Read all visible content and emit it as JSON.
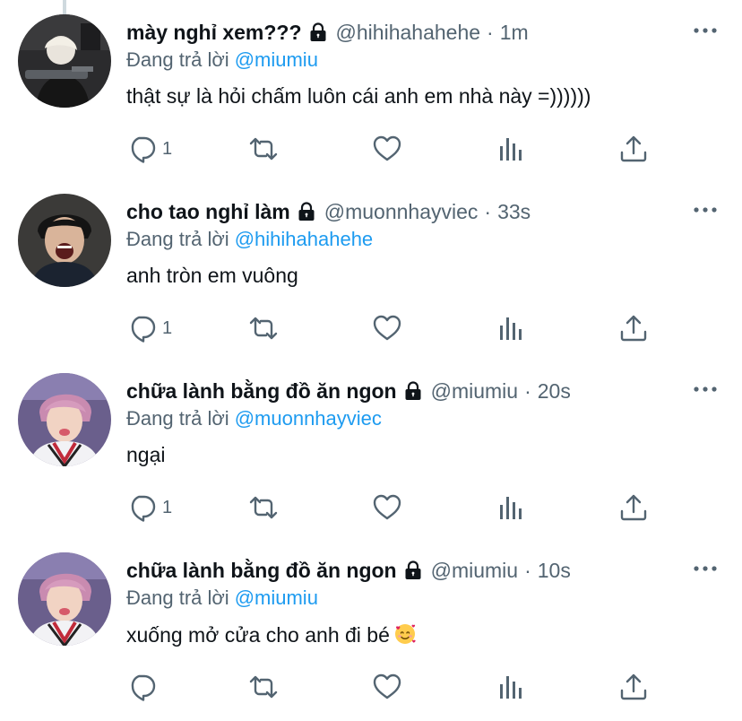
{
  "colors": {
    "text": "#0f1419",
    "secondary": "#536471",
    "link": "#1d9bf0",
    "thread_line": "#cfd9de"
  },
  "icons": {
    "lock": "lock-icon",
    "more": "more-dots-icon",
    "reply": "reply-bubble-icon",
    "retweet": "retweet-icon",
    "like": "heart-icon",
    "stats": "analytics-bars-icon",
    "share": "share-upload-icon",
    "emoji": "smiling-face-with-hearts-emoji"
  },
  "tweets": [
    {
      "name": "mày nghỉ xem???",
      "handle": "@hihihahahehe",
      "time": "1m",
      "reply_prefix": "Đang trả lời",
      "reply_to": "@miumiu",
      "text": "thật sự là hỏi chấm luôn cái anh em nhà này =))))))",
      "reply_count": "1"
    },
    {
      "name": "cho tao nghỉ làm",
      "handle": "@muonnhayviec",
      "time": "33s",
      "reply_prefix": "Đang trả lời",
      "reply_to": "@hihihahahehe",
      "text": "anh tròn em vuông",
      "reply_count": "1"
    },
    {
      "name": "chữa lành bằng đồ ăn ngon",
      "handle": "@miumiu",
      "time": "20s",
      "reply_prefix": "Đang trả lời",
      "reply_to": "@muonnhayviec",
      "text": "ngại",
      "reply_count": "1"
    },
    {
      "name": "chữa lành bằng đồ ăn ngon",
      "handle": "@miumiu",
      "time": "10s",
      "reply_prefix": "Đang trả lời",
      "reply_to": "@miumiu",
      "text": "xuống mở cửa cho anh đi bé",
      "reply_count": ""
    }
  ]
}
